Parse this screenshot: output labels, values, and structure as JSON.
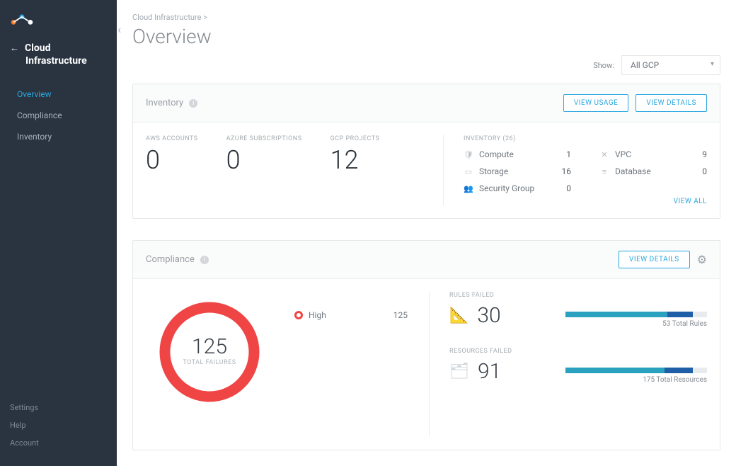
{
  "sidebar": {
    "module_line1": "Cloud",
    "module_line2": "Infrastructure",
    "menu": [
      "Overview",
      "Compliance",
      "Inventory"
    ],
    "active_index": 0,
    "footer": [
      "Settings",
      "Help",
      "Account"
    ]
  },
  "breadcrumb": "Cloud Infrastructure >",
  "page_title": "Overview",
  "show_label": "Show:",
  "show_value": "All GCP",
  "inventory_panel": {
    "title": "Inventory",
    "btn_usage": "VIEW USAGE",
    "btn_details": "VIEW DETAILS",
    "counters": [
      {
        "label": "AWS ACCOUNTS",
        "value": "0"
      },
      {
        "label": "AZURE SUBSCRIPTIONS",
        "value": "0"
      },
      {
        "label": "GCP PROJECTS",
        "value": "12"
      }
    ],
    "list_label": "INVENTORY (26)",
    "items": [
      {
        "icon": "shield",
        "name": "Compute",
        "count": "1"
      },
      {
        "icon": "net",
        "name": "VPC",
        "count": "9"
      },
      {
        "icon": "disk",
        "name": "Storage",
        "count": "16"
      },
      {
        "icon": "db",
        "name": "Database",
        "count": "0"
      },
      {
        "icon": "group",
        "name": "Security Group",
        "count": "0"
      }
    ],
    "view_all": "VIEW ALL"
  },
  "compliance_panel": {
    "title": "Compliance",
    "btn_details": "VIEW DETAILS",
    "total_failures": "125",
    "total_failures_label": "TOTAL FAILURES",
    "legend_high": "High",
    "legend_high_value": "125",
    "rules_failed_label": "RULES FAILED",
    "rules_failed": "30",
    "rules_total": "53 Total Rules",
    "resources_failed_label": "RESOURCES FAILED",
    "resources_failed": "91",
    "resources_total": "175 Total Resources"
  },
  "chart_data": [
    {
      "type": "pie",
      "title": "Total Failures",
      "series": [
        {
          "name": "High",
          "values": [
            125
          ]
        }
      ],
      "total": 125,
      "colors": {
        "High": "#f04545"
      }
    },
    {
      "type": "bar",
      "title": "Rules Failed",
      "categories": [
        "Rules"
      ],
      "values": [
        30
      ],
      "total": 53,
      "ylim": [
        0,
        53
      ]
    },
    {
      "type": "bar",
      "title": "Resources Failed",
      "categories": [
        "Resources"
      ],
      "values": [
        91
      ],
      "total": 175,
      "ylim": [
        0,
        175
      ]
    }
  ]
}
